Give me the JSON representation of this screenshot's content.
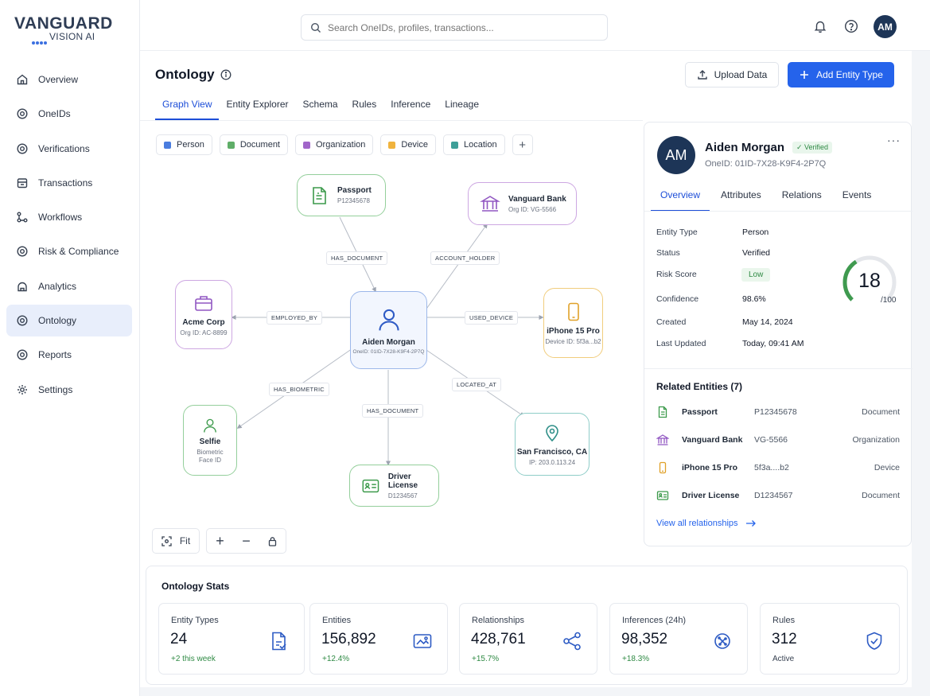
{
  "brand": {
    "main": "VANGUARD",
    "sub": "VISION AI"
  },
  "sidebar": {
    "items": [
      {
        "label": "Overview",
        "icon": "home-icon"
      },
      {
        "label": "OneIDs",
        "icon": "target-icon"
      },
      {
        "label": "Verifications",
        "icon": "verify-icon"
      },
      {
        "label": "Transactions",
        "icon": "transactions-icon"
      },
      {
        "label": "Workflows",
        "icon": "workflow-icon"
      },
      {
        "label": "Risk & Compliance",
        "icon": "risk-icon"
      },
      {
        "label": "Analytics",
        "icon": "analytics-icon"
      },
      {
        "label": "Ontology",
        "icon": "ontology-icon",
        "active": true
      },
      {
        "label": "Reports",
        "icon": "reports-icon"
      },
      {
        "label": "Settings",
        "icon": "gear-icon"
      }
    ]
  },
  "header": {
    "search_placeholder": "Search OneIDs, profiles, transactions...",
    "avatar_initials": "AM"
  },
  "page": {
    "title": "Ontology",
    "upload_label": "Upload Data",
    "add_label": "Add Entity Type",
    "tabs": [
      "Graph View",
      "Entity Explorer",
      "Schema",
      "Rules",
      "Inference",
      "Lineage"
    ]
  },
  "legend": [
    {
      "label": "Person",
      "color": "#4a7ddf"
    },
    {
      "label": "Document",
      "color": "#5fae68"
    },
    {
      "label": "Organization",
      "color": "#a166c9"
    },
    {
      "label": "Device",
      "color": "#f0b33d"
    },
    {
      "label": "Location",
      "color": "#3e9f98"
    }
  ],
  "graph": {
    "center": {
      "name": "Aiden Morgan",
      "sub": "OneID: 01ID-7X28-K9F4-2P7Q"
    },
    "nodes": {
      "passport": {
        "name": "Passport",
        "sub": "P12345678"
      },
      "bank": {
        "name": "Vanguard Bank",
        "sub": "Org ID: VG-5566"
      },
      "acme": {
        "name": "Acme Corp",
        "sub": "Org ID: AC-8899"
      },
      "iphone": {
        "name": "iPhone 15 Pro",
        "sub": "Device ID: 5f3a...b2"
      },
      "selfie": {
        "name": "Selfie",
        "sub1": "Biometric",
        "sub2": "Face ID"
      },
      "license": {
        "name": "Driver License",
        "sub": "D1234567"
      },
      "sf": {
        "name": "San Francisco, CA",
        "sub": "IP: 203.0.113.24"
      }
    },
    "relations": {
      "has_document_top": "HAS_DOCUMENT",
      "account_holder": "ACCOUNT_HOLDER",
      "employed_by": "EMPLOYED_BY",
      "used_device": "USED_DEVICE",
      "has_biometric": "HAS_BIOMETRIC",
      "located_at": "LOCATED_AT",
      "has_document_bottom": "HAS_DOCUMENT"
    },
    "fit_label": "Fit"
  },
  "detail": {
    "initials": "AM",
    "name": "Aiden Morgan",
    "verified": "✓ Verified",
    "oneid": "OneID: 01ID-7X28-K9F4-2P7Q",
    "tabs": [
      "Overview",
      "Attributes",
      "Relations",
      "Events"
    ],
    "fields": [
      {
        "key": "Entity Type",
        "value": "Person"
      },
      {
        "key": "Status",
        "value": "Verified"
      },
      {
        "key": "Risk Score",
        "value": "Low"
      },
      {
        "key": "Confidence",
        "value": "98.6%"
      },
      {
        "key": "Created",
        "value": "May 14, 2024"
      },
      {
        "key": "Last Updated",
        "value": "Today, 09:41 AM"
      }
    ],
    "risk_value": "18",
    "risk_max": "/100",
    "risk_fraction": 0.18,
    "related_title": "Related Entities (7)",
    "related": [
      {
        "name": "Passport",
        "id": "P12345678",
        "type": "Document",
        "icon": "document-icon"
      },
      {
        "name": "Vanguard Bank",
        "id": "VG-5566",
        "type": "Organization",
        "icon": "bank-icon"
      },
      {
        "name": "iPhone 15 Pro",
        "id": "5f3a....b2",
        "type": "Device",
        "icon": "phone-icon"
      },
      {
        "name": "Driver License",
        "id": "D1234567",
        "type": "Document",
        "icon": "id-card-icon"
      }
    ],
    "view_all": "View all relationships"
  },
  "stats": {
    "title": "Ontology Stats",
    "cards": [
      {
        "label": "Entity Types",
        "value": "24",
        "delta": "+2 this week",
        "icon": "entity-types-icon"
      },
      {
        "label": "Entities",
        "value": "156,892",
        "delta": "+12.4%",
        "icon": "entities-icon"
      },
      {
        "label": "Relationships",
        "value": "428,761",
        "delta": "+15.7%",
        "icon": "share-icon"
      },
      {
        "label": "Inferences (24h)",
        "value": "98,352",
        "delta": "+18.3%",
        "icon": "inference-icon"
      },
      {
        "label": "Rules",
        "value": "312",
        "delta": "Active",
        "icon": "shield-check-icon"
      }
    ]
  }
}
